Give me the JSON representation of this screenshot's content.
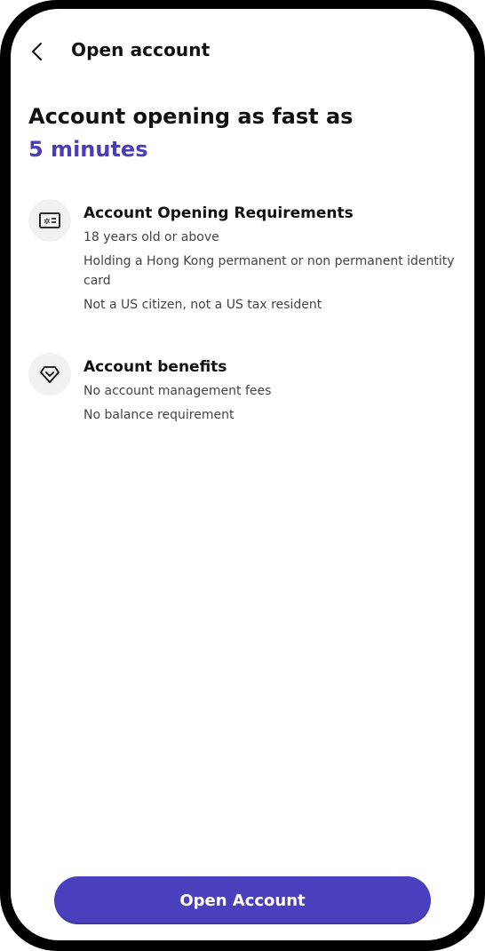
{
  "colors": {
    "accent": "#4A3DB8",
    "cta_background": "#4A3FBC",
    "icon_background": "#F1F1F4"
  },
  "header": {
    "back_icon": "chevron-left-icon",
    "title": "Open account"
  },
  "hero": {
    "line1": "Account opening as fast as",
    "line2": "5 minutes"
  },
  "requirements": {
    "icon": "id-card-icon",
    "title": "Account Opening Requirements",
    "items": [
      "18 years old or above",
      "Holding a Hong Kong permanent or non permanent identity card",
      "Not a US citizen, not a US tax resident"
    ]
  },
  "benefits": {
    "icon": "diamond-icon",
    "title": "Account benefits",
    "items": [
      "No account management fees",
      "No balance requirement"
    ]
  },
  "cta": {
    "label": "Open Account"
  }
}
